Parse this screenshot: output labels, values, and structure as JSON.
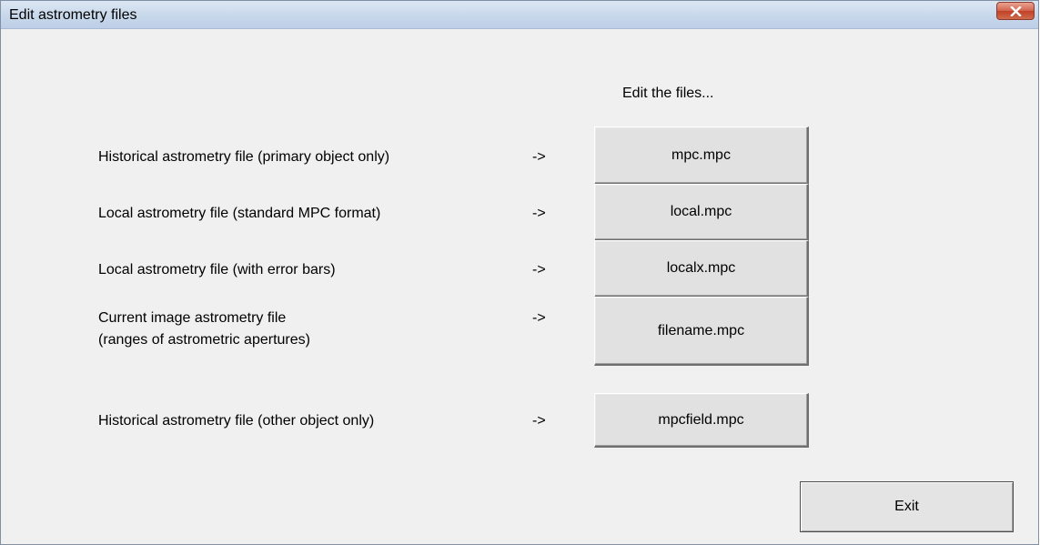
{
  "window": {
    "title": "Edit astrometry files"
  },
  "header": {
    "edit_files_label": "Edit the files..."
  },
  "rows": [
    {
      "description_line1": "Historical astrometry file (primary object only)",
      "description_line2": "",
      "arrow": "->",
      "button_label": "mpc.mpc"
    },
    {
      "description_line1": "Local astrometry file (standard MPC format)",
      "description_line2": "",
      "arrow": "->",
      "button_label": "local.mpc"
    },
    {
      "description_line1": "Local astrometry file (with error bars)",
      "description_line2": "",
      "arrow": "->",
      "button_label": "localx.mpc"
    },
    {
      "description_line1": "Current image astrometry file",
      "description_line2": "(ranges of astrometric apertures)",
      "arrow": "->",
      "button_label": "filename.mpc"
    },
    {
      "description_line1": "Historical astrometry file (other object only)",
      "description_line2": "",
      "arrow": "->",
      "button_label": "mpcfield.mpc"
    }
  ],
  "footer": {
    "exit_label": "Exit"
  },
  "colors": {
    "dialog_background": "#f0f0f0",
    "titlebar": "#cbdaec",
    "close_button": "#c75a42"
  },
  "icons": {
    "close": "close-icon"
  }
}
